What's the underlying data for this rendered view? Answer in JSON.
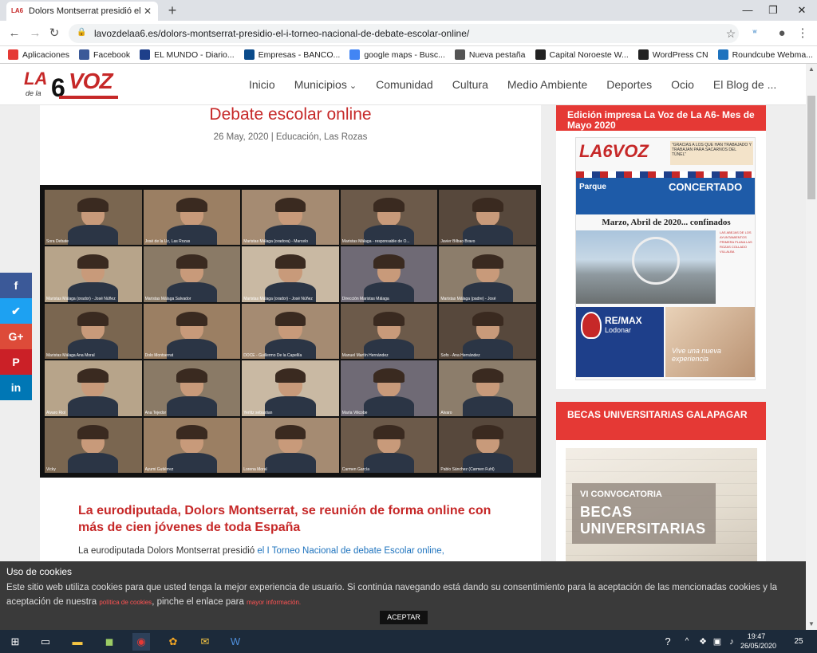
{
  "browser": {
    "tab_title": "Dolors Montserrat presidió el I To",
    "tab_favicon": "LA6",
    "url": "lavozdelaa6.es/dolors-montserrat-presidio-el-i-torneo-nacional-de-debate-escolar-online/",
    "bookmarks": [
      {
        "label": "Aplicaciones",
        "icon": "apps-grid-icon",
        "color": "#e53935"
      },
      {
        "label": "Facebook",
        "icon": "facebook-icon",
        "color": "#3b5998"
      },
      {
        "label": "EL MUNDO - Diario...",
        "icon": "globe-icon",
        "color": "#1e3f8a"
      },
      {
        "label": "Empresas - BANCO...",
        "icon": "bank-icon",
        "color": "#0a4a8a"
      },
      {
        "label": "google maps - Busc...",
        "icon": "google-icon",
        "color": "#4285f4"
      },
      {
        "label": "Nueva pestaña",
        "icon": "globe-icon",
        "color": "#555555"
      },
      {
        "label": "Capital Noroeste W...",
        "icon": "cn-icon",
        "color": "#222222"
      },
      {
        "label": "WordPress CN",
        "icon": "cn-icon",
        "color": "#222222"
      },
      {
        "label": "Roundcube Webma...",
        "icon": "roundcube-icon",
        "color": "#1e73be"
      }
    ]
  },
  "site": {
    "logo_text_la": "LA",
    "logo_text_six": "6",
    "logo_text_voz": "VOZ",
    "logo_text_dela": "de la",
    "menu": [
      "Inicio",
      "Municipios",
      "Comunidad",
      "Cultura",
      "Medio Ambiente",
      "Deportes",
      "Ocio",
      "El Blog de ..."
    ],
    "accent_color": "#c62828"
  },
  "article": {
    "title": "Debate escolar online",
    "date": "26 May, 2020",
    "separator": "|",
    "categories": [
      "Educación",
      "Las Rozas"
    ],
    "participants": [
      "Sora Debate",
      "José de la Uz, Las Rozas",
      "Maristas Málaga (oradora) - Marcelo",
      "Maristas Málaga - responsable de O...",
      "Javier Bilbao Bravo",
      "Maristas Málaga (orador) - José Núñez",
      "Maristas Málaga Salvador",
      "Maristas Málaga (orador) - José Núñez",
      "Dirección Maristas Málaga",
      "Maristas Málaga (padre) - José",
      "Maristas Málaga Ana Moral",
      "Dolo Montserrat",
      "DOCE - Guillermo De la Capellía",
      "Manuel Martín Hernández",
      "Sofo - Ana Hernández",
      "Álvaro Riol",
      "Ana Tejedor",
      "Yerlitz sebastian",
      "María Vilicobe",
      "Álvaro",
      "Vicky",
      "Ayumi Gutiérrez",
      "Lorena Moral",
      "Carmen García",
      "Pablo Sánchez (Carmen Fuhl)"
    ],
    "subheading": "La eurodiputada, Dolors Montserrat, se reunión de forma online con más de cien jóvenes de toda España",
    "paragraph_start": "La eurodiputada Dolors Montserrat presidió ",
    "paragraph_link": "el I Torneo Nacional de debate Escolar online,"
  },
  "social": [
    {
      "icon": "facebook-icon",
      "glyph": "f",
      "color": "#3b5998"
    },
    {
      "icon": "twitter-icon",
      "glyph": "✔",
      "color": "#1da1f2"
    },
    {
      "icon": "google-plus-icon",
      "glyph": "G+",
      "color": "#dd4b39"
    },
    {
      "icon": "pinterest-icon",
      "glyph": "P",
      "color": "#cb2027"
    },
    {
      "icon": "linkedin-icon",
      "glyph": "in",
      "color": "#0077b5"
    }
  ],
  "sidebar": {
    "widget1_title": "Edición impresa La Voz de La A6- Mes de Mayo 2020",
    "newspaper": {
      "masthead": "LA6VOZ",
      "quote": "\"GRACIAS A LOS QUE HAN TRABAJADO Y TRABAJAN PARA SACARNOS DEL TÚNEL\"",
      "ad1_left": "Parque",
      "ad1_right": "CONCERTADO",
      "headline": "Marzo, Abril de 2020... confinados",
      "col_text": "LAS ABEJAS DE LOS AYUNTAMIENTOS PRIMERA PLANA LAS ROZAS COLLADO VILLALBA",
      "ad2_brand": "RE/MAX",
      "ad2_sub": "Lodonar",
      "ad3_text": "Vive una nueva experiencia"
    },
    "widget2_title": "BECAS UNIVERSITARIAS GALAPAGAR",
    "becas": {
      "line1": "VI CONVOCATORIA",
      "line2": "BECAS",
      "line3": "UNIVERSITARIAS"
    }
  },
  "cookie": {
    "title": "Uso de cookies",
    "text_a": "Este sitio web utiliza cookies para que usted tenga la mejor experiencia de usuario. Si continúa navegando está dando su consentimiento para la aceptación de las mencionadas cookies y la aceptación de nuestra ",
    "policy_link": "política de cookies",
    "text_b": ", pinche el enlace para ",
    "info_link": "mayor información.",
    "accept": "ACEPTAR"
  },
  "taskbar": {
    "time": "19:47",
    "date": "26/05/2020",
    "notifications": "25"
  }
}
